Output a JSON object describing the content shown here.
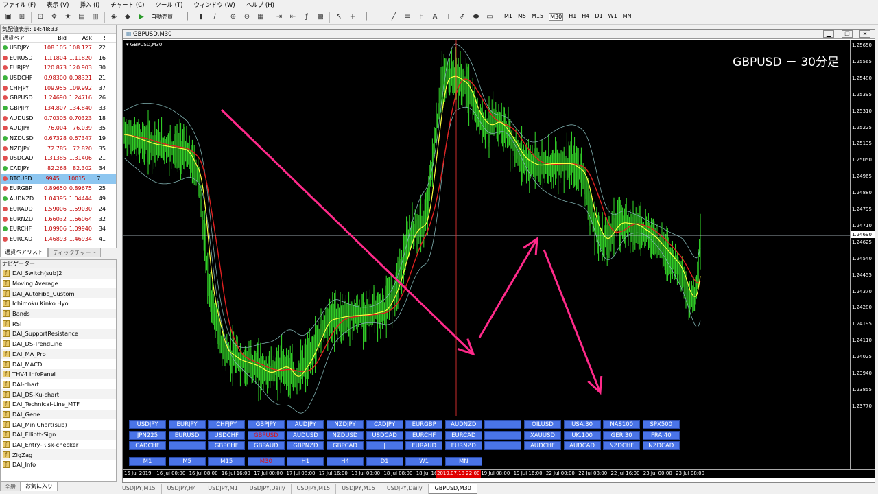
{
  "menu": [
    "ファイル (F)",
    "表示 (V)",
    "挿入 (I)",
    "チャート (C)",
    "ツール (T)",
    "ウィンドウ (W)",
    "ヘルプ (H)"
  ],
  "toolbar": {
    "autotrade": "自動売買",
    "timeframes": [
      "M1",
      "M5",
      "M15",
      "M30",
      "H1",
      "H4",
      "D1",
      "W1",
      "MN"
    ]
  },
  "market_watch": {
    "title": "気配値表示: 14:48:33",
    "headers": {
      "symbol": "通貨ペア",
      "bid": "Bid",
      "ask": "Ask",
      "spread": "!"
    },
    "rows": [
      {
        "symbol": "USDJPY",
        "bid": "108.105",
        "ask": "108.127",
        "spread": "22"
      },
      {
        "symbol": "EURUSD",
        "bid": "1.11804",
        "ask": "1.11820",
        "spread": "16"
      },
      {
        "symbol": "EURJPY",
        "bid": "120.873",
        "ask": "120.903",
        "spread": "30"
      },
      {
        "symbol": "USDCHF",
        "bid": "0.98300",
        "ask": "0.98321",
        "spread": "21"
      },
      {
        "symbol": "CHFJPY",
        "bid": "109.955",
        "ask": "109.992",
        "spread": "37"
      },
      {
        "symbol": "GBPUSD",
        "bid": "1.24690",
        "ask": "1.24716",
        "spread": "26"
      },
      {
        "symbol": "GBPJPY",
        "bid": "134.807",
        "ask": "134.840",
        "spread": "33"
      },
      {
        "symbol": "AUDUSD",
        "bid": "0.70305",
        "ask": "0.70323",
        "spread": "18"
      },
      {
        "symbol": "AUDJPY",
        "bid": "76.004",
        "ask": "76.039",
        "spread": "35"
      },
      {
        "symbol": "NZDUSD",
        "bid": "0.67328",
        "ask": "0.67347",
        "spread": "19"
      },
      {
        "symbol": "NZDJPY",
        "bid": "72.785",
        "ask": "72.820",
        "spread": "35"
      },
      {
        "symbol": "USDCAD",
        "bid": "1.31385",
        "ask": "1.31406",
        "spread": "21"
      },
      {
        "symbol": "CADJPY",
        "bid": "82.268",
        "ask": "82.302",
        "spread": "34"
      },
      {
        "symbol": "BTCUSD",
        "bid": "9945....",
        "ask": "10015....",
        "spread": "7..."
      },
      {
        "symbol": "EURGBP",
        "bid": "0.89650",
        "ask": "0.89675",
        "spread": "25"
      },
      {
        "symbol": "AUDNZD",
        "bid": "1.04395",
        "ask": "1.04444",
        "spread": "49"
      },
      {
        "symbol": "EURAUD",
        "bid": "1.59006",
        "ask": "1.59030",
        "spread": "24"
      },
      {
        "symbol": "EURNZD",
        "bid": "1.66032",
        "ask": "1.66064",
        "spread": "32"
      },
      {
        "symbol": "EURCHF",
        "bid": "1.09906",
        "ask": "1.09940",
        "spread": "34"
      },
      {
        "symbol": "EURCAD",
        "bid": "1.46893",
        "ask": "1.46934",
        "spread": "41"
      }
    ],
    "selected": "BTCUSD",
    "tabs": [
      "通貨ペアリスト",
      "ティックチャート"
    ]
  },
  "navigator": {
    "title": "ナビゲーター",
    "items": [
      "DAI_Switch(sub)2",
      "Moving Average",
      "DAI_AutoFibo_Custom",
      "Ichimoku Kinko Hyo",
      "Bands",
      "RSI",
      "DAI_SupportResistance",
      "DAI_DS-TrendLine",
      "DAI_MA_Pro",
      "DAI_MACD",
      "THV4 InfoPanel",
      "DAI-chart",
      "DAI_DS-Ku-chart",
      "DAI_Technical-Line_MTF",
      "DAI_Gene",
      "DAI_MiniChart(sub)",
      "DAI_Elliott-Sign",
      "DAI_Entry-Risk-checker",
      "ZigZag",
      "DAI_Info"
    ],
    "tabs": [
      "全般",
      "お気に入り"
    ]
  },
  "chart_window": {
    "title": "GBPUSD,M30",
    "inner_label": "GBPUSD,M30",
    "overlay_title": "GBPUSD － 30分足",
    "price_tag": "1.24690",
    "y_labels": [
      "1.25650",
      "1.25565",
      "1.25480",
      "1.25395",
      "1.25310",
      "1.25225",
      "1.25135",
      "1.25050",
      "1.24965",
      "1.24880",
      "1.24795",
      "1.24710",
      "1.24625",
      "1.24540",
      "1.24455",
      "1.24370",
      "1.24280",
      "1.24195",
      "1.24110",
      "1.24025",
      "1.23940",
      "1.23855",
      "1.23770"
    ],
    "x_labels": [
      "15 Jul 2019",
      "16 Jul 00:00",
      "16 Jul 08:00",
      "16 Jul 16:00",
      "17 Jul 00:00",
      "17 Jul 08:00",
      "17 Jul 16:00",
      "18 Jul 00:00",
      "18 Jul 08:00",
      "18 Jul 16:00",
      "19 Jul 00:00",
      "19 Jul 08:00",
      "19 Jul 16:00",
      "22 Jul 00:00",
      "22 Jul 08:00",
      "22 Jul 16:00",
      "23 Jul 00:00",
      "23 Jul 08:00"
    ],
    "x_highlight": "2019.07.18 22:00",
    "panel_rows": [
      [
        "USDJPY",
        "EURJPY",
        "CHFJPY",
        "GBPJPY",
        "AUDJPY",
        "NZDJPY",
        "CADJPY",
        "EURGBP",
        "AUDNZD",
        "|",
        "OILUSD",
        "USA.30",
        "NAS100",
        "SPX500"
      ],
      [
        "JPN225",
        "EURUSD",
        "USDCHF",
        "GBPUSD",
        "AUDUSD",
        "NZDUSD",
        "USDCAD",
        "EURCHF",
        "EURCAD",
        "|",
        "XAUUSD",
        "UK.100",
        "GER.30",
        "FRA.40"
      ],
      [
        "CADCHF",
        "|",
        "GBPCHF",
        "GBPAUD",
        "GBPNZD",
        "GBPCAD",
        "|",
        "EURAUD",
        "EURNZD",
        "|",
        "AUDCHF",
        "AUDCAD",
        "NZDCHF",
        "NZDCAD"
      ],
      [
        "M1",
        "M5",
        "M15",
        "M30",
        "H1",
        "H4",
        "D1",
        "W1",
        "MN"
      ]
    ],
    "panel_active": [
      "GBPUSD",
      "M30"
    ]
  },
  "bottom_tabs": [
    "USDJPY,M15",
    "USDJPY,H4",
    "USDJPY,M1",
    "USDJPY,Daily",
    "USDJPY,M15",
    "USDJPY,M15",
    "USDJPY,Daily",
    "GBPUSD,M30"
  ],
  "bottom_active": "GBPUSD,M30",
  "colors": {
    "candle": "#35e02a",
    "ma_fast": "#ffff40",
    "ma_slow": "#e02020",
    "bands": "#7fb0b0",
    "arrow": "#ff2a8a",
    "panel": "#4a74e8"
  }
}
